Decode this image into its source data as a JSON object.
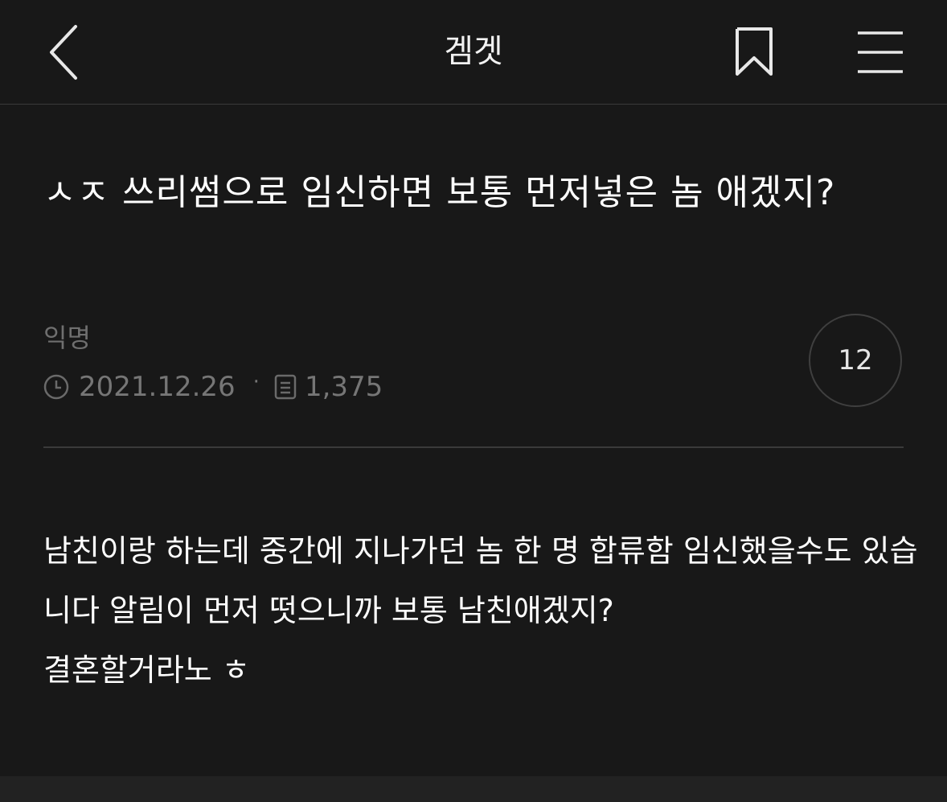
{
  "header": {
    "title": "겜겟",
    "back_icon": "chevron-left-icon",
    "bookmark_icon": "bookmark-icon",
    "menu_icon": "hamburger-menu-icon"
  },
  "post": {
    "title": "ㅅㅈ 쓰리썸으로 임신하면 보통 먼저넣은 놈 애겠지?",
    "author": "익명",
    "date": "2021.12.26",
    "separator": "·",
    "views": "1,375",
    "comment_count": "12",
    "body": "남친이랑 하는데 중간에 지나가던 놈 한 명 합류함 임신했을수도 있습니다 알림이 먼저 떳으니까 보통 남친애겠지?\n결혼할거라노 ㅎ"
  },
  "colors": {
    "background": "#181818",
    "text": "#ffffff",
    "muted": "#767676",
    "divider": "#3a3a3a"
  }
}
